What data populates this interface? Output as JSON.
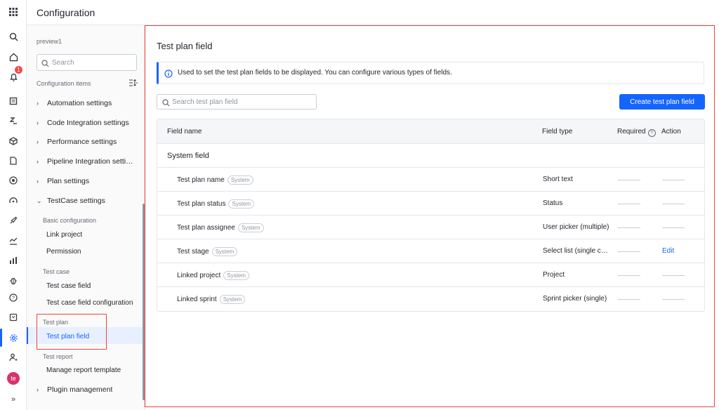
{
  "header": {
    "title": "Configuration"
  },
  "rail": {
    "notification_count": "1",
    "avatar_text": "te"
  },
  "sidebar": {
    "project": "preview1",
    "search_placeholder": "Search",
    "config_items_label": "Configuration items",
    "groups": [
      {
        "label": "Automation settings"
      },
      {
        "label": "Code Integration settings"
      },
      {
        "label": "Performance settings"
      },
      {
        "label": "Pipeline Integration settings"
      },
      {
        "label": "Plan settings"
      },
      {
        "label": "TestCase settings"
      },
      {
        "label": "Plugin management"
      }
    ],
    "sections": [
      {
        "heading": "Basic configuration",
        "items": [
          "Link project",
          "Permission"
        ]
      },
      {
        "heading": "Test case",
        "items": [
          "Test case field",
          "Test case field configuration"
        ]
      },
      {
        "heading": "Test plan",
        "items": [
          "Test plan field"
        ]
      },
      {
        "heading": "Test report",
        "items": [
          "Manage report template"
        ]
      }
    ]
  },
  "main": {
    "title": "Test plan field",
    "info": "Used to set the test plan fields to be displayed. You can configure various types of fields.",
    "search_placeholder": "Search test plan field",
    "create_button": "Create test plan field",
    "columns": {
      "name": "Field name",
      "type": "Field type",
      "required": "Required",
      "action": "Action"
    },
    "system_group": "System field",
    "tag": "System",
    "edit_label": "Edit",
    "rows": [
      {
        "name": "Test plan name",
        "type": "Short text"
      },
      {
        "name": "Test plan status",
        "type": "Status"
      },
      {
        "name": "Test plan assignee",
        "type": "User picker (multiple)"
      },
      {
        "name": "Test stage",
        "type": "Select list (single choice)"
      },
      {
        "name": "Linked project",
        "type": "Project"
      },
      {
        "name": "Linked sprint",
        "type": "Sprint picker (single)"
      }
    ]
  }
}
